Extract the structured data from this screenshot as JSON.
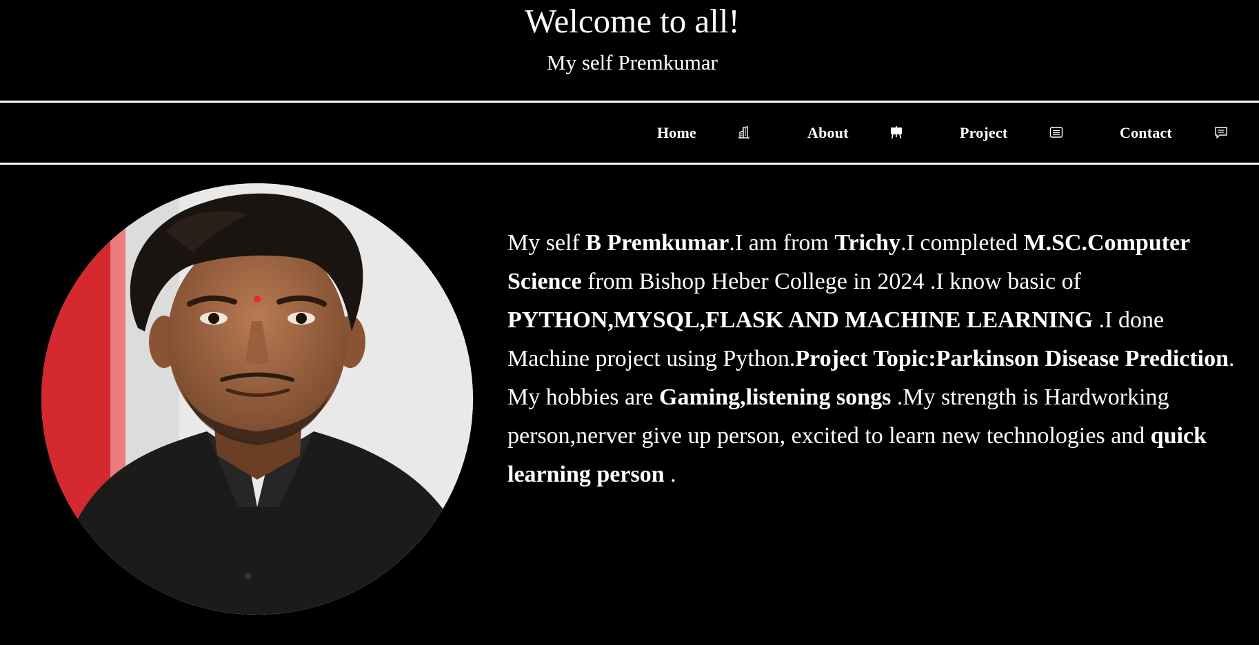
{
  "header": {
    "title": "Welcome to all!",
    "subtitle": "My self Premkumar"
  },
  "nav": {
    "items": [
      {
        "label": "Home",
        "icon": "building-icon"
      },
      {
        "label": "About",
        "icon": "easel-icon"
      },
      {
        "label": "Project",
        "icon": "list-icon"
      },
      {
        "label": "Contact",
        "icon": "chat-icon"
      }
    ]
  },
  "profile": {
    "photo": "profile-photo"
  },
  "bio": {
    "p1": {
      "t1": "My self ",
      "b1": "B Premkumar",
      "t2": ".I am from ",
      "b2": "Trichy",
      "t3": ".I completed ",
      "b3": "M.SC.Computer Science",
      "t4": " from Bishop Heber College in 2024 .I know basic of ",
      "b4": "PYTHON,MYSQL,FLASK AND MACHINE LEARNING",
      "t5": " .I done Machine project using Python.",
      "b5": "Project Topic:Parkinson Disease Prediction",
      "t6": "."
    },
    "p2": {
      "t1": "My hobbies are ",
      "b1": "Gaming,listening songs",
      "t2": " .My strength is Hardworking person,nerver give up person, excited to learn new technologies and ",
      "b2": "quick learning person",
      "t3": " ."
    }
  },
  "colors": {
    "background": "#000000",
    "text": "#ffffff",
    "rule": "#ffffff"
  }
}
